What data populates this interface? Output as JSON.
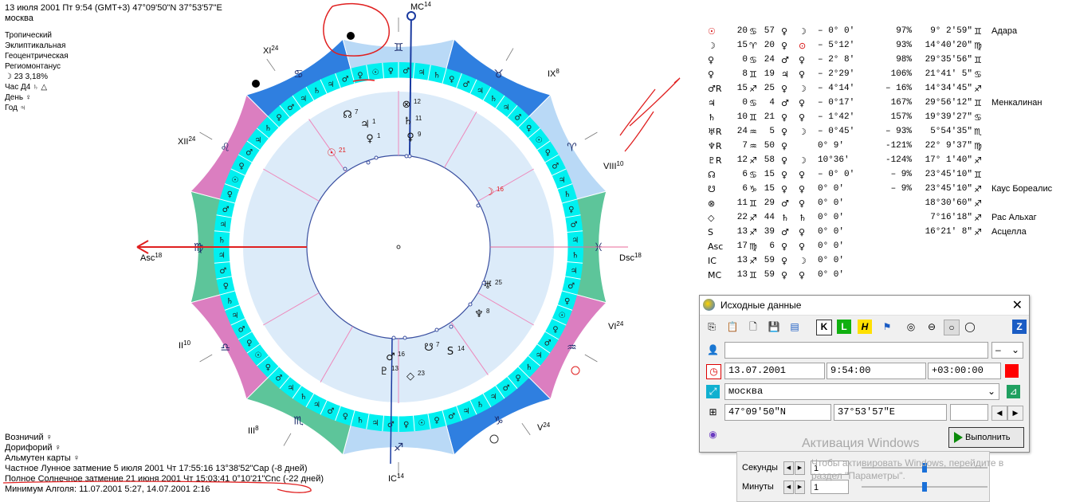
{
  "header": {
    "line1": "13 июля 2001   Пт   9:54 (GMT+3) 47°09'50\"N  37°53'57\"E",
    "line2": "москва"
  },
  "settings": [
    "Тропический",
    "Эклиптикальная",
    "Геоцентрическая",
    "Региомонтанус"
  ],
  "moon_phase": "☽   23 3,18%",
  "hour": "Час Д4 ♄ △",
  "day": "День ♀",
  "year": "Год ♃",
  "bottom": {
    "vozn": "Возничий ♀",
    "dorif": "Дорифорий ♀",
    "almuten": "Альмутен карты ♀",
    "lunar": "Частное Лунное затмение 5 июля 2001 Чт 17:55:16 13°38'52\"Cap (-8 дней)",
    "solar": "Полное Солнечное затмение 21 июня 2001 Чт 15:03:41  0°10'21\"Cnc (-22 дней)",
    "algol": "Минимум Алголя: 11.07.2001  5:27,  14.07.2001  2:16"
  },
  "chart": {
    "house_labels": [
      {
        "text": "MC",
        "sup": "14"
      },
      {
        "text": "IX",
        "sup": "8"
      },
      {
        "text": "VIII",
        "sup": "10"
      },
      {
        "text": "Dsc",
        "sup": "18"
      },
      {
        "text": "VI",
        "sup": "24"
      },
      {
        "text": "V",
        "sup": "24"
      },
      {
        "text": "IC",
        "sup": "14"
      },
      {
        "text": "III",
        "sup": "8"
      },
      {
        "text": "II",
        "sup": "10"
      },
      {
        "text": "Asc",
        "sup": "18"
      },
      {
        "text": "XII",
        "sup": "24"
      },
      {
        "text": "XI",
        "sup": "24"
      }
    ],
    "inner_planets": [
      {
        "glyph": "☉",
        "deg": "21"
      },
      {
        "glyph": "☊",
        "deg": "7"
      },
      {
        "glyph": "♃",
        "deg": "1"
      },
      {
        "glyph": "♀",
        "deg": "1"
      },
      {
        "glyph": "⊗",
        "deg": "12"
      },
      {
        "glyph": "♄",
        "deg": "11"
      },
      {
        "glyph": "♀",
        "deg": "9"
      },
      {
        "glyph": "☽",
        "deg": "16"
      },
      {
        "glyph": "♅",
        "deg": "25"
      },
      {
        "glyph": "♆",
        "deg": "8"
      },
      {
        "glyph": "☋",
        "deg": "7"
      },
      {
        "glyph": "S",
        "deg": "14"
      },
      {
        "glyph": "♂",
        "deg": "16"
      },
      {
        "glyph": "♇",
        "deg": "13"
      },
      {
        "glyph": "◇",
        "deg": "23"
      }
    ],
    "retro_mark": "R",
    "asc_moon_glyph": "☽",
    "colors": {
      "blue": "#2f7fe0",
      "lightblue": "#b9d9f6",
      "green": "#5dc59a",
      "pink": "#db7ec0",
      "cyan": "#00f0f0",
      "fill": "#dcebf9",
      "red": "#e02020"
    }
  },
  "planets": [
    {
      "sym": "☉",
      "deg": "20",
      "sign": "♋",
      "min": "57",
      "ruler": "♀",
      "asp": "☽",
      "orb": "– 0° 0'",
      "pct": "97%",
      "pos": "9° 2'59\"",
      "psign": "♊",
      "star": "Адара"
    },
    {
      "sym": "☽",
      "deg": "15",
      "sign": "♈",
      "min": "20",
      "ruler": "♀",
      "asp": "⊙",
      "orb": "– 5°12'",
      "pct": "93%",
      "pos": "14°40'20\"",
      "psign": "♍",
      "star": ""
    },
    {
      "sym": "♀",
      "deg": "0",
      "sign": "♋",
      "min": "24",
      "ruler": "♂",
      "asp": "♀",
      "orb": "– 2° 8'",
      "pct": "98%",
      "pos": "29°35'56\"",
      "psign": "♊",
      "star": ""
    },
    {
      "sym": "♀",
      "deg": "8",
      "sign": "♊",
      "min": "19",
      "ruler": "♃",
      "asp": "♀",
      "orb": "– 2°29'",
      "pct": "106%",
      "pos": "21°41' 5\"",
      "psign": "♋",
      "star": ""
    },
    {
      "sym": "♂R",
      "deg": "15",
      "sign": "♐",
      "min": "25",
      "ruler": "♀",
      "asp": "☽",
      "orb": "– 4°14'",
      "pct": "– 16%",
      "pos": "14°34'45\"",
      "psign": "♐",
      "star": ""
    },
    {
      "sym": "♃",
      "deg": "0",
      "sign": "♋",
      "min": "4",
      "ruler": "♂",
      "asp": "♀",
      "orb": "– 0°17'",
      "pct": "167%",
      "pos": "29°56'12\"",
      "psign": "♊",
      "star": "Менкалинан"
    },
    {
      "sym": "♄",
      "deg": "10",
      "sign": "♊",
      "min": "21",
      "ruler": "♀",
      "asp": "♀",
      "orb": "– 1°42'",
      "pct": "157%",
      "pos": "19°39'27\"",
      "psign": "♋",
      "star": ""
    },
    {
      "sym": "♅R",
      "deg": "24",
      "sign": "♒",
      "min": "5",
      "ruler": "♀",
      "asp": "☽",
      "orb": "– 0°45'",
      "pct": "– 93%",
      "pos": "5°54'35\"",
      "psign": "♏",
      "star": ""
    },
    {
      "sym": "♆R",
      "deg": "7",
      "sign": "♒",
      "min": "50",
      "ruler": "♀",
      "asp": "",
      "orb": "0° 9'",
      "pct": "-121%",
      "pos": "22° 9'37\"",
      "psign": "♍",
      "star": ""
    },
    {
      "sym": "♇R",
      "deg": "12",
      "sign": "♐",
      "min": "58",
      "ruler": "♀",
      "asp": "☽",
      "orb": "10°36'",
      "pct": "-124%",
      "pos": "17° 1'40\"",
      "psign": "♐",
      "star": ""
    },
    {
      "sym": "☊",
      "deg": "6",
      "sign": "♋",
      "min": "15",
      "ruler": "♀",
      "asp": "♀",
      "orb": "– 0° 0'",
      "pct": "– 9%",
      "pos": "23°45'10\"",
      "psign": "♊",
      "star": ""
    },
    {
      "sym": "☋",
      "deg": "6",
      "sign": "♑",
      "min": "15",
      "ruler": "♀",
      "asp": "♀",
      "orb": "0° 0'",
      "pct": "– 9%",
      "pos": "23°45'10\"",
      "psign": "♐",
      "star": "Каус Бореалис"
    },
    {
      "sym": "⊗",
      "deg": "11",
      "sign": "♊",
      "min": "29",
      "ruler": "♂",
      "asp": "♀",
      "orb": "0° 0'",
      "pct": "",
      "pos": "18°30'60\"",
      "psign": "♐",
      "star": ""
    },
    {
      "sym": "◇",
      "deg": "22",
      "sign": "♐",
      "min": "44",
      "ruler": "♄",
      "asp": "♄",
      "orb": "0° 0'",
      "pct": "",
      "pos": "7°16'18\"",
      "psign": "♐",
      "star": "Рас Альхаг"
    },
    {
      "sym": "S",
      "deg": "13",
      "sign": "♐",
      "min": "39",
      "ruler": "♂",
      "asp": "♀",
      "orb": "0° 0'",
      "pct": "",
      "pos": "16°21' 8\"",
      "psign": "♐",
      "star": "Асцелла"
    },
    {
      "sym": "Asc",
      "deg": "17",
      "sign": "♍",
      "min": "6",
      "ruler": "♀",
      "asp": "♀",
      "orb": "0° 0'",
      "pct": "",
      "pos": "",
      "psign": "",
      "star": ""
    },
    {
      "sym": "IC",
      "deg": "13",
      "sign": "♐",
      "min": "59",
      "ruler": "♀",
      "asp": "☽",
      "orb": "0° 0'",
      "pct": "",
      "pos": "",
      "psign": "",
      "star": ""
    },
    {
      "sym": "MC",
      "deg": "13",
      "sign": "♊",
      "min": "59",
      "ruler": "♀",
      "asp": "♀",
      "orb": "0° 0'",
      "pct": "",
      "pos": "",
      "psign": "",
      "star": ""
    }
  ],
  "dialog": {
    "title": "Исходные данные",
    "name_value": "",
    "gender": "–",
    "date": "13.07.2001",
    "time": "9:54:00",
    "tz": "+03:00:00",
    "place": "москва",
    "lat": "47°09'50\"N",
    "lon": "37°53'57\"E",
    "exec": "Выполнить",
    "toolbar_letters": [
      "K",
      "L",
      "H",
      "Z"
    ]
  },
  "watermark": {
    "title": "Активация Windows",
    "sub1": "Чтобы активировать Windows, перейдите в",
    "sub2": "раздел \"Параметры\"."
  },
  "sliders": {
    "sec_label": "Секунды",
    "sec_value": "1",
    "sec_level": 0.5,
    "min_label": "Минуты",
    "min_value": "1",
    "min_level": 0.5
  }
}
